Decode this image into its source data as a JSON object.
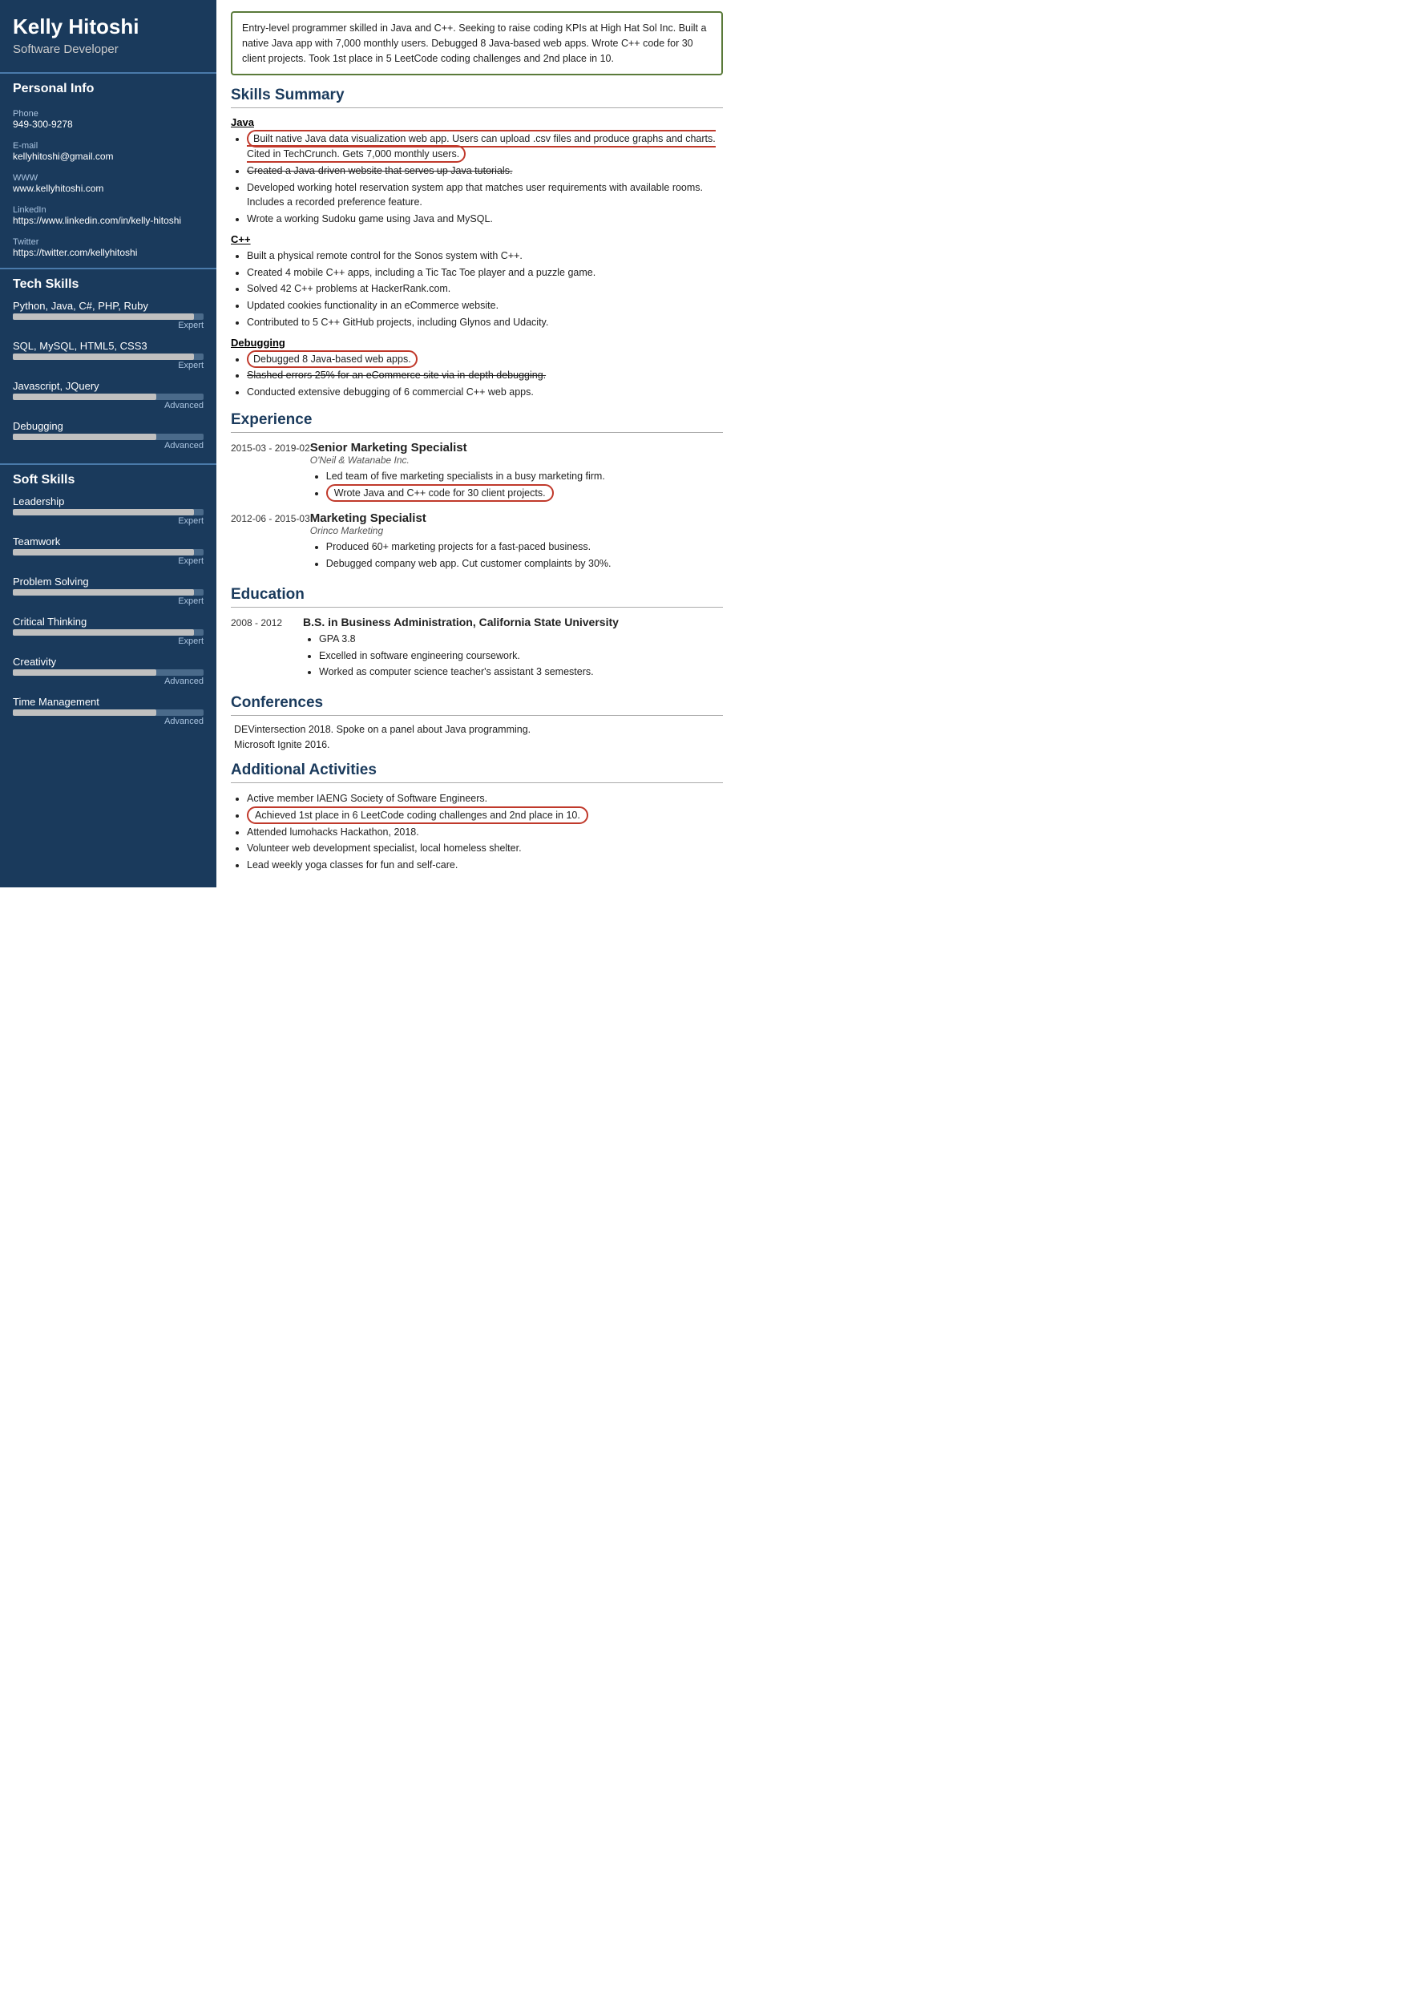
{
  "sidebar": {
    "name": "Kelly Hitoshi",
    "title": "Software Developer",
    "personal_info_title": "Personal Info",
    "contact": [
      {
        "label": "Phone",
        "value": "949-300-9278"
      },
      {
        "label": "E-mail",
        "value": "kellyhitoshi@gmail.com"
      },
      {
        "label": "WWW",
        "value": "www.kellyhitoshi.com"
      },
      {
        "label": "LinkedIn",
        "value": "https://www.linkedin.com/in/kelly-hitoshi"
      },
      {
        "label": "Twitter",
        "value": "https://twitter.com/kellyhitoshi"
      }
    ],
    "tech_skills_title": "Tech Skills",
    "tech_skills": [
      {
        "name": "Python, Java, C#, PHP, Ruby",
        "level": "Expert",
        "pct": 95
      },
      {
        "name": "SQL, MySQL, HTML5, CSS3",
        "level": "Expert",
        "pct": 95
      },
      {
        "name": "Javascript, JQuery",
        "level": "Advanced",
        "pct": 75
      },
      {
        "name": "Debugging",
        "level": "Advanced",
        "pct": 75
      }
    ],
    "soft_skills_title": "Soft Skills",
    "soft_skills": [
      {
        "name": "Leadership",
        "level": "Expert",
        "pct": 95
      },
      {
        "name": "Teamwork",
        "level": "Expert",
        "pct": 95
      },
      {
        "name": "Problem Solving",
        "level": "Expert",
        "pct": 95
      },
      {
        "name": "Critical Thinking",
        "level": "Expert",
        "pct": 95
      },
      {
        "name": "Creativity",
        "level": "Advanced",
        "pct": 75
      },
      {
        "name": "Time Management",
        "level": "Advanced",
        "pct": 75
      }
    ]
  },
  "main": {
    "summary": "Entry-level programmer skilled in Java and C++. Seeking to raise coding KPIs at High Hat Sol Inc. Built a native Java app with 7,000 monthly users. Debugged 8 Java-based web apps. Wrote C++ code for 30 client projects. Took 1st place in 5 LeetCode coding challenges and 2nd place in 10.",
    "skills_summary_title": "Skills Summary",
    "java_title": "Java",
    "java_bullets": [
      "Built native Java data visualization web app. Users can upload .csv files and produce graphs and charts. Cited in TechCrunch. Gets 7,000 monthly users.",
      "Created a Java-driven website that serves up Java tutorials.",
      "Developed working hotel reservation system app that matches user requirements with available rooms. Includes a recorded preference feature.",
      "Wrote a working Sudoku game using Java and MySQL."
    ],
    "cpp_title": "C++",
    "cpp_bullets": [
      "Built a physical remote control for the Sonos system with C++.",
      "Created 4 mobile C++ apps, including a Tic Tac Toe player and a puzzle game.",
      "Solved 42 C++ problems at HackerRank.com.",
      "Updated cookies functionality in an eCommerce website.",
      "Contributed to 5 C++ GitHub projects, including Glynos and Udacity."
    ],
    "debugging_title": "Debugging",
    "debugging_bullets": [
      "Debugged 8 Java-based web apps.",
      "Slashed errors 25% for an eCommerce site via in-depth debugging.",
      "Conducted extensive debugging of 6 commercial C++ web apps."
    ],
    "experience_title": "Experience",
    "experiences": [
      {
        "date": "2015-03 - 2019-02",
        "job_title": "Senior Marketing Specialist",
        "company": "O'Neil & Watanabe Inc.",
        "bullets": [
          "Led team of five marketing specialists in a busy marketing firm.",
          "Wrote Java and C++ code for 30 client projects."
        ],
        "highlight_bullet": 1
      },
      {
        "date": "2012-06 - 2015-03",
        "job_title": "Marketing Specialist",
        "company": "Orinco Marketing",
        "bullets": [
          "Produced 60+ marketing projects for a fast-paced business.",
          "Debugged company web app. Cut customer complaints by 30%."
        ],
        "highlight_bullet": -1
      }
    ],
    "education_title": "Education",
    "education": [
      {
        "date": "2008 - 2012",
        "degree": "B.S. in Business Administration, California State University",
        "bullets": [
          "GPA 3.8",
          "Excelled in software engineering coursework.",
          "Worked as computer science teacher's assistant 3 semesters."
        ]
      }
    ],
    "conferences_title": "Conferences",
    "conferences": [
      "DEVintersection 2018. Spoke on a panel about Java programming.",
      "Microsoft Ignite 2016."
    ],
    "additional_title": "Additional Activities",
    "additional_bullets": [
      "Active member IAENG Society of Software Engineers.",
      "Achieved 1st place in 6 LeetCode coding challenges and 2nd place in 10.",
      "Attended lumohacks Hackathon, 2018.",
      "Volunteer web development specialist, local homeless shelter.",
      "Lead weekly yoga classes for fun and self-care."
    ],
    "highlight_additional_bullet": 1
  }
}
